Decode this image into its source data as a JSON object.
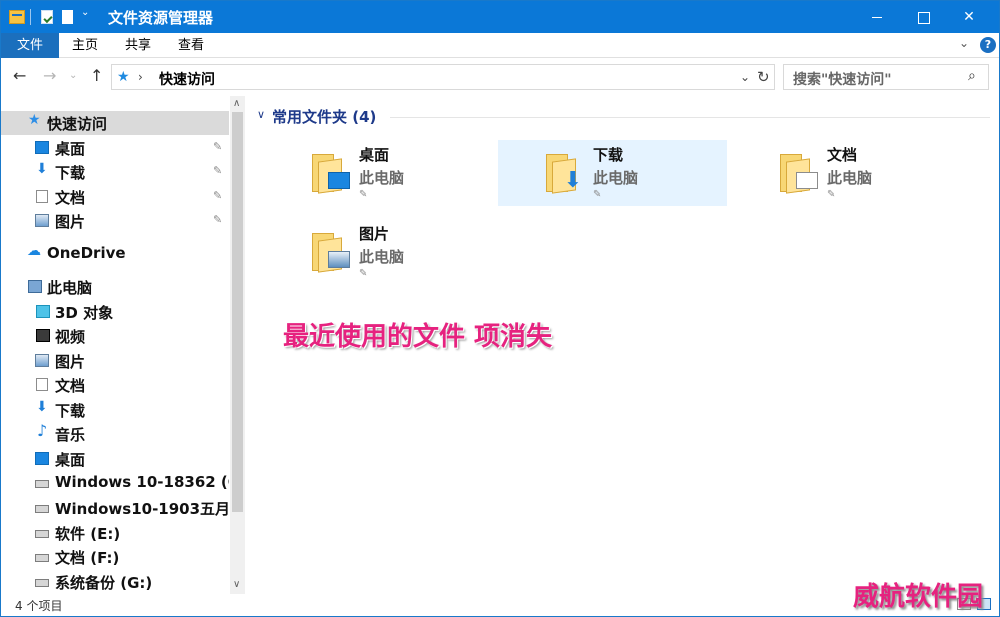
{
  "window": {
    "title": "文件资源管理器",
    "accent_color": "#0b78d7"
  },
  "quick_access_toolbar": {
    "items": [
      "folder-icon",
      "properties-icon",
      "new-folder-icon",
      "customize-dropdown-icon"
    ],
    "dropdown_glyph": "⌄"
  },
  "ribbon": {
    "tabs": [
      {
        "label": "文件",
        "active": true
      },
      {
        "label": "主页"
      },
      {
        "label": "共享"
      },
      {
        "label": "查看"
      }
    ],
    "expand_glyph": "⌄",
    "help_glyph": "?"
  },
  "address": {
    "back_glyph": "←",
    "forward_glyph": "→",
    "recent_glyph": "⌄",
    "up_glyph": "↑",
    "star_glyph": "★",
    "separator_glyph": "›",
    "path": "快速访问",
    "dropdown_glyph": "⌄",
    "refresh_glyph": "↻"
  },
  "search": {
    "placeholder": "搜索\"快速访问\"",
    "icon_glyph": "⌕"
  },
  "nav": {
    "items": [
      {
        "label": "快速访问",
        "icon": "star-icon",
        "glyph": "★",
        "selected": true
      },
      {
        "label": "桌面",
        "icon": "desktop-icon",
        "glyph": "",
        "pinned": true
      },
      {
        "label": "下载",
        "icon": "download-icon",
        "glyph": "⬇",
        "pinned": true
      },
      {
        "label": "文档",
        "icon": "document-icon",
        "glyph": "",
        "pinned": true
      },
      {
        "label": "图片",
        "icon": "pictures-icon",
        "glyph": "",
        "pinned": true
      },
      {
        "label": "OneDrive",
        "icon": "cloud-icon",
        "glyph": "☁"
      },
      {
        "label": "此电脑",
        "icon": "computer-icon",
        "glyph": ""
      },
      {
        "label": "3D 对象",
        "icon": "3d-objects-icon",
        "glyph": ""
      },
      {
        "label": "视频",
        "icon": "video-icon",
        "glyph": ""
      },
      {
        "label": "图片",
        "icon": "pictures-icon",
        "glyph": ""
      },
      {
        "label": "文档",
        "icon": "document-icon",
        "glyph": ""
      },
      {
        "label": "下载",
        "icon": "download-icon",
        "glyph": "⬇"
      },
      {
        "label": "音乐",
        "icon": "music-icon",
        "glyph": "♪"
      },
      {
        "label": "桌面",
        "icon": "desktop-icon",
        "glyph": ""
      },
      {
        "label": "Windows 10-18362 (C",
        "icon": "windows-drive-icon",
        "glyph": ""
      },
      {
        "label": "Windows10-1903五月",
        "icon": "drive-icon",
        "glyph": ""
      },
      {
        "label": "软件 (E:)",
        "icon": "drive-icon",
        "glyph": ""
      },
      {
        "label": "文档 (F:)",
        "icon": "drive-icon",
        "glyph": ""
      },
      {
        "label": "系统备份 (G:)",
        "icon": "drive-icon",
        "glyph": ""
      }
    ],
    "pin_glyph": "📌",
    "scroll_up_glyph": "∧",
    "scroll_down_glyph": "∨"
  },
  "content": {
    "group": {
      "chevron_glyph": "∨",
      "title": "常用文件夹 (4)"
    },
    "folders": [
      {
        "name": "桌面",
        "location": "此电脑",
        "overlay": "desktop",
        "hovered": false
      },
      {
        "name": "下载",
        "location": "此电脑",
        "overlay": "download",
        "hovered": true
      },
      {
        "name": "文档",
        "location": "此电脑",
        "overlay": "document",
        "hovered": false
      },
      {
        "name": "图片",
        "location": "此电脑",
        "overlay": "pictures",
        "hovered": false
      }
    ],
    "pin_glyph": "📌",
    "annotation": "最近使用的文件 项消失"
  },
  "status": {
    "item_count": "4 个项目"
  },
  "watermark": "威航软件园"
}
